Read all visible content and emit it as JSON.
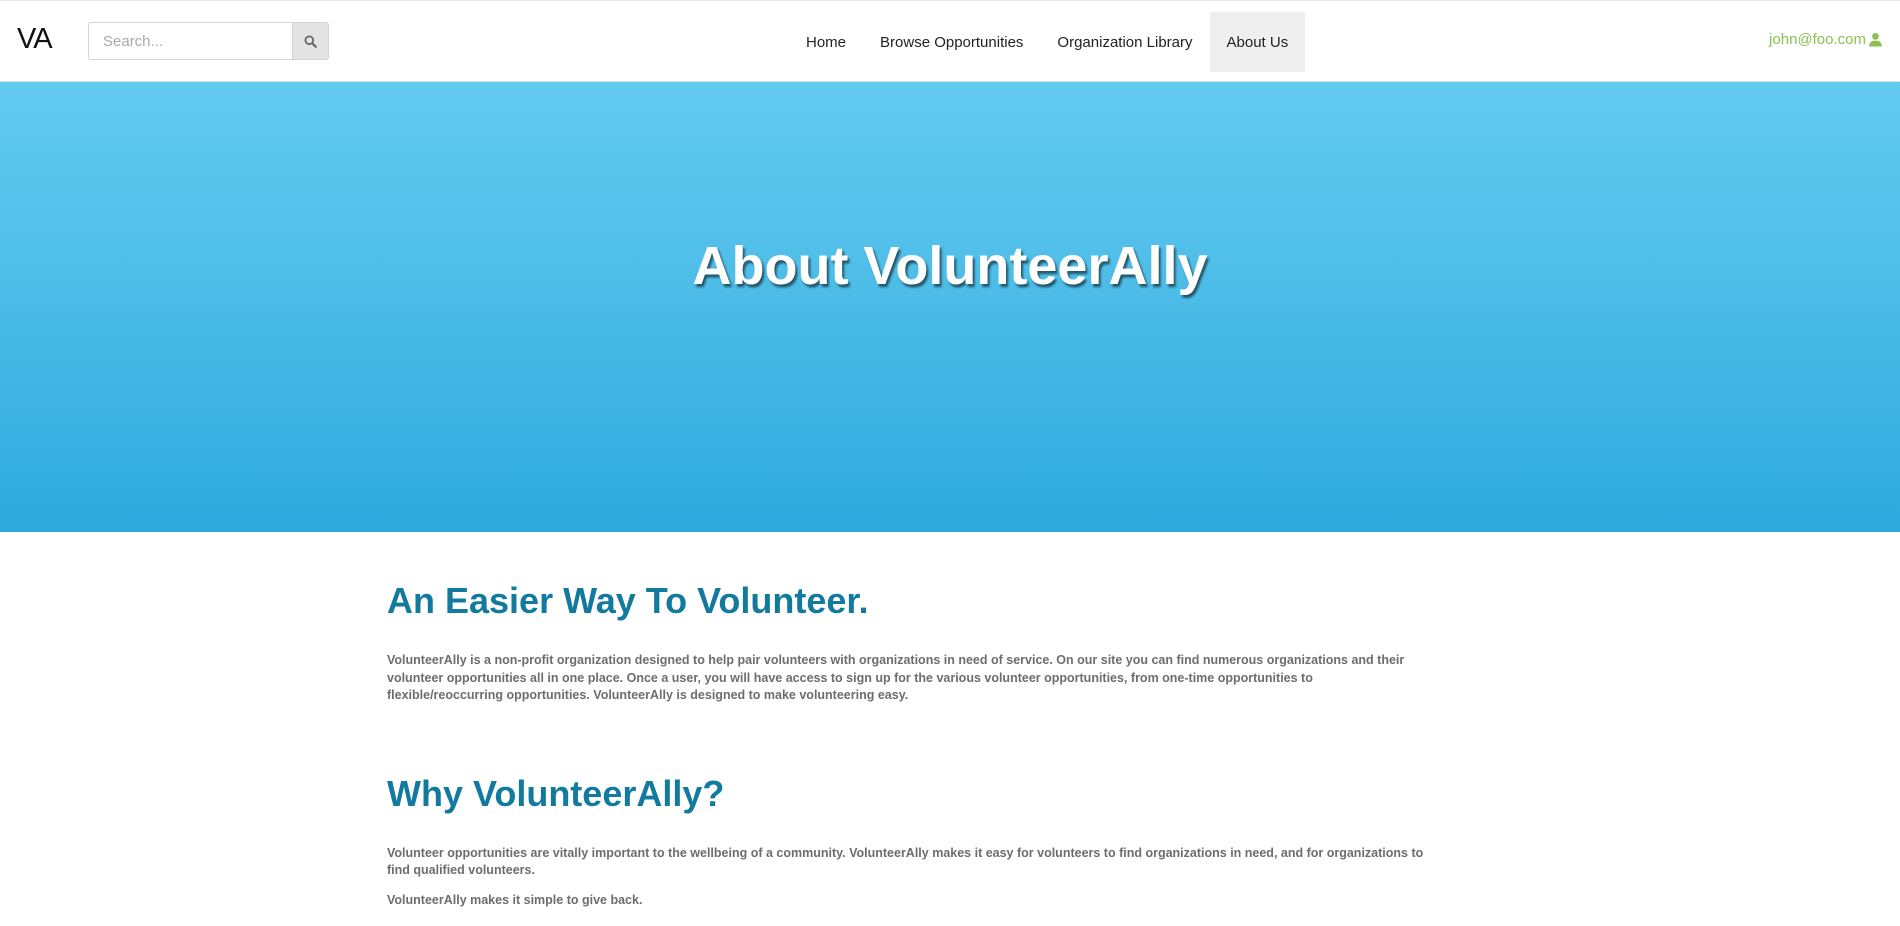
{
  "navbar": {
    "brand": "VA",
    "search": {
      "placeholder": "Search...",
      "value": ""
    },
    "menu": [
      {
        "label": "Home",
        "active": false
      },
      {
        "label": "Browse Opportunities",
        "active": false
      },
      {
        "label": "Organization Library",
        "active": false
      },
      {
        "label": "About Us",
        "active": true
      }
    ],
    "user": {
      "email": "john@foo.com",
      "icon": "user-icon"
    }
  },
  "hero": {
    "title": "About VolunteerAlly"
  },
  "sections": [
    {
      "heading": "An Easier Way To Volunteer.",
      "paragraphs": [
        "VolunteerAlly is a non-profit organization designed to help pair volunteers with organizations in need of service. On our site you can find numerous organizations and their volunteer opportunities all in one place. Once a user, you will have access to sign up for the various volunteer opportunities, from one-time opportunities to flexible/reoccurring opportunities. VolunteerAlly is designed to make volunteering easy."
      ]
    },
    {
      "heading": "Why VolunteerAlly?",
      "paragraphs": [
        "Volunteer opportunities are vitally important to the wellbeing of a community. VolunteerAlly makes it easy for volunteers to find organizations in need, and for organizations to find qualified volunteers.",
        "VolunteerAlly makes it simple to give back."
      ]
    }
  ],
  "colors": {
    "accent_heading": "#117a9e",
    "user_link": "#8cc152",
    "hero_top": "#63cbf0",
    "hero_bottom": "#2ea9dd"
  }
}
